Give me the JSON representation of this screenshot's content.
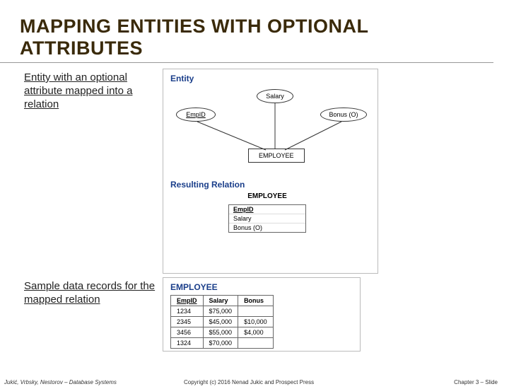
{
  "title": "MAPPING ENTITIES WITH OPTIONAL ATTRIBUTES",
  "caption1": "Entity with an optional attribute mapped into a relation",
  "caption2": "Sample data records for the mapped relation",
  "sections": {
    "entity": "Entity",
    "resulting": "Resulting Relation"
  },
  "er": {
    "emp_id": "EmpID",
    "salary": "Salary",
    "bonus": "Bonus (O)",
    "entity_name": "EMPLOYEE"
  },
  "relation": {
    "name": "EMPLOYEE",
    "attrs": [
      "EmpID",
      "Salary",
      "Bonus (O)"
    ]
  },
  "sample": {
    "label": "EMPLOYEE",
    "cols": [
      "EmpID",
      "Salary",
      "Bonus"
    ],
    "rows": [
      [
        "1234",
        "$75,000",
        ""
      ],
      [
        "2345",
        "$45,000",
        "$10,000"
      ],
      [
        "3456",
        "$55,000",
        "$4,000"
      ],
      [
        "1324",
        "$70,000",
        ""
      ]
    ]
  },
  "footer": {
    "left": "Jukić, Vrbsky, Nestorov – Database Systems",
    "mid": "Copyright (c) 2016 Nenad Jukic and Prospect Press",
    "right": "Chapter 3 – Slide"
  }
}
